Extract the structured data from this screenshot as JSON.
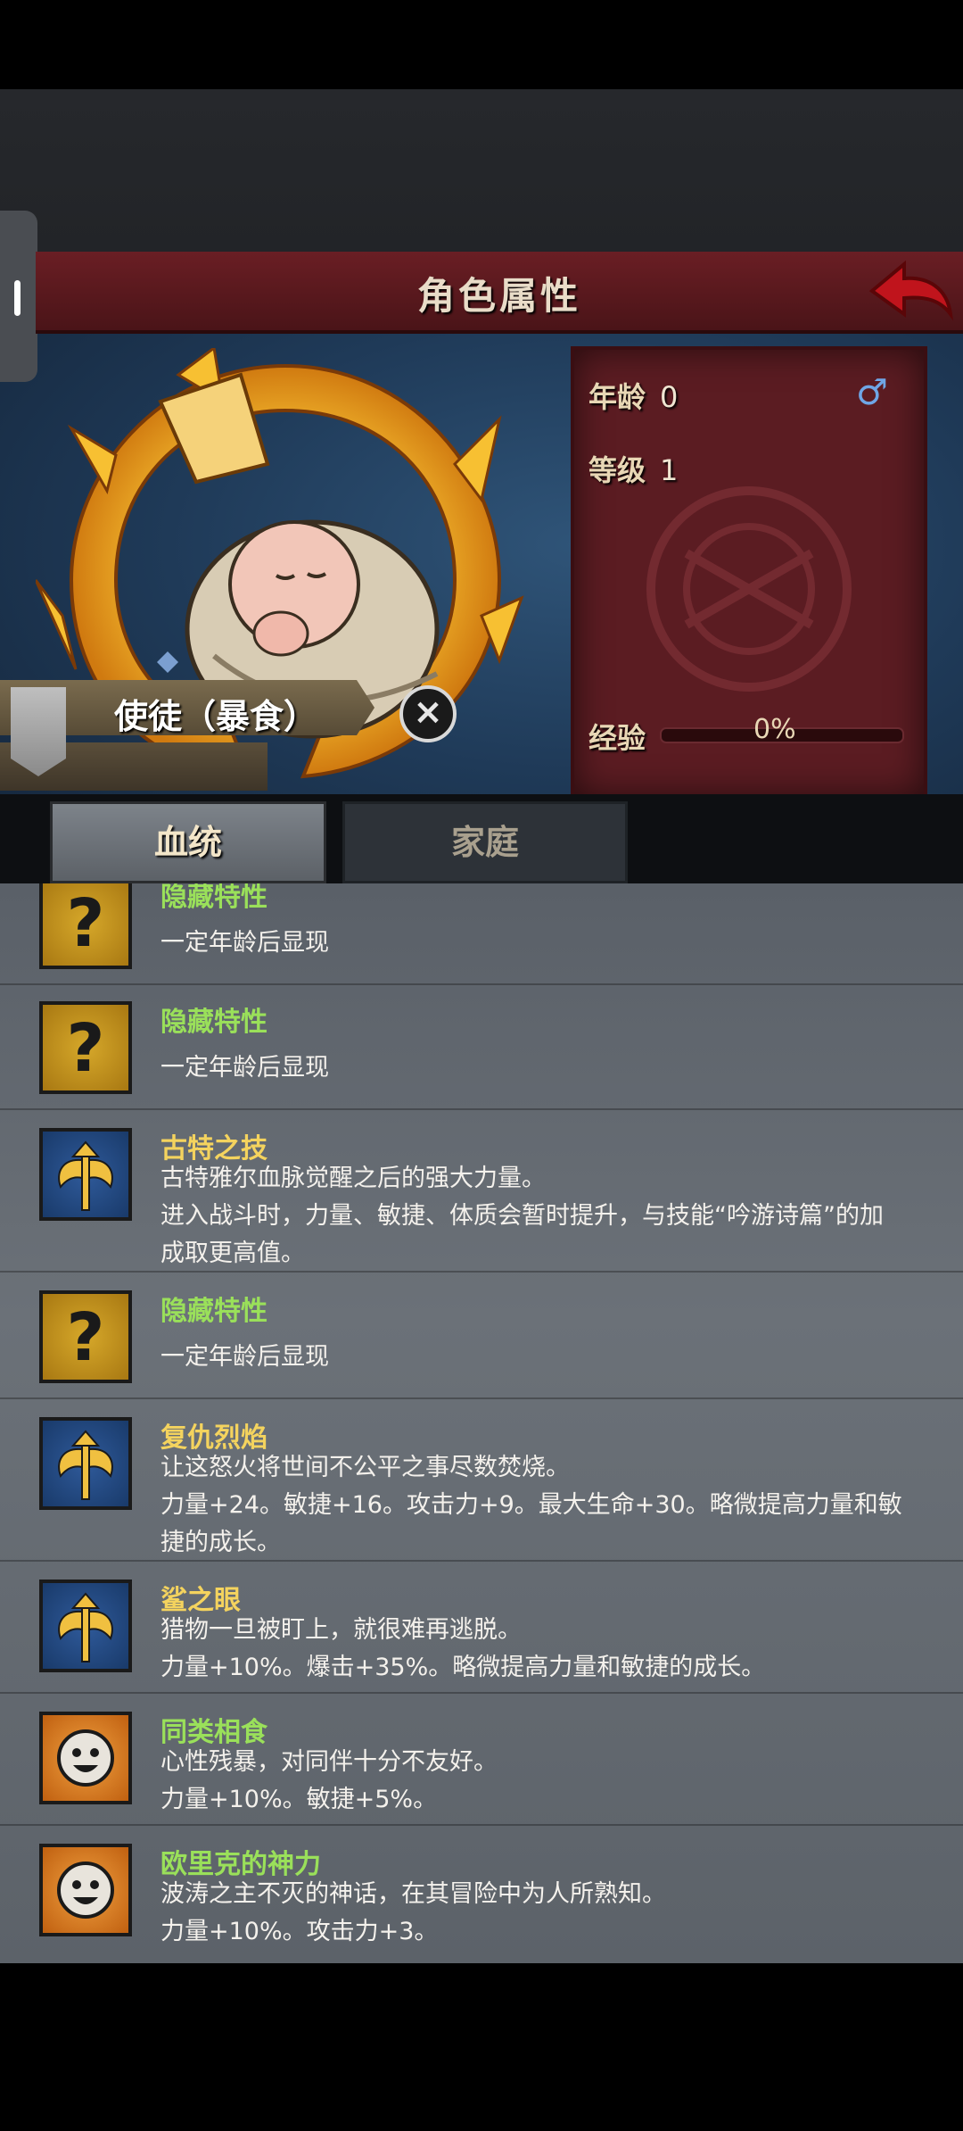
{
  "header": {
    "title": "角色属性"
  },
  "character": {
    "age_label": "年龄",
    "age_value": "0",
    "level_label": "等级",
    "level_value": "1",
    "exp_label": "经验",
    "exp_value": "0%",
    "exp_fraction": 0,
    "name": "使徒（暴食）",
    "gender_icon": "male-icon"
  },
  "tabs": [
    {
      "label": "血统"
    },
    {
      "label": "家庭"
    }
  ],
  "traits": [
    {
      "title": "隐藏特性",
      "desc": "一定年龄后显现",
      "icon": "question-icon",
      "title_color": "green"
    },
    {
      "title": "隐藏特性",
      "desc": "一定年龄后显现",
      "icon": "question-icon",
      "title_color": "green"
    },
    {
      "title": "古特之技",
      "desc": "古特雅尔血脉觉醒之后的强大力量。进入战斗时，力量、敏捷、体质会暂时提升，与技能“吟游诗篇”的加成取更高值。",
      "icon": "axe-icon",
      "title_color": "yellow"
    },
    {
      "title": "隐藏特性",
      "desc": "一定年龄后显现",
      "icon": "question-icon",
      "title_color": "green"
    },
    {
      "title": "复仇烈焰",
      "desc": "让这怒火将世间不公平之事尽数焚烧。力量+24。敏捷+16。攻击力+9。最大生命+30。略微提高力量和敏捷的成长。",
      "icon": "axe-icon",
      "title_color": "yellow"
    },
    {
      "title": "鲨之眼",
      "desc": "猎物一旦被盯上，就很难再逃脱。力量+10%。爆击+35%。略微提高力量和敏捷的成长。",
      "icon": "axe-icon",
      "title_color": "yellow"
    },
    {
      "title": "同类相食",
      "desc": "心性残暴，对同伴十分不友好。力量+10%。敏捷+5%。",
      "icon": "smile-icon",
      "title_color": "green"
    },
    {
      "title": "欧里克的神力",
      "desc": "波涛之主不灭的神话，在其冒险中为人所熟知。力量+10%。攻击力+3。",
      "icon": "smile-icon",
      "title_color": "green"
    }
  ],
  "trait_lines": [
    [
      "一定年龄后显现"
    ],
    [
      "一定年龄后显现"
    ],
    [
      "古特雅尔血脉觉醒之后的强大力量。",
      "进入战斗时，力量、敏捷、体质会暂时提升，与技能“吟游诗篇”的加",
      "成取更高值。"
    ],
    [
      "一定年龄后显现"
    ],
    [
      "让这怒火将世间不公平之事尽数焚烧。",
      "力量+24。敏捷+16。攻击力+9。最大生命+30。略微提高力量和敏",
      "捷的成长。"
    ],
    [
      "猎物一旦被盯上，就很难再逃脱。",
      "力量+10%。爆击+35%。略微提高力量和敏捷的成长。"
    ],
    [
      "心性残暴，对同伴十分不友好。",
      "力量+10%。敏捷+5%。"
    ],
    [
      "波涛之主不灭的神话，在其冒险中为人所熟知。",
      "力量+10%。攻击力+3。"
    ]
  ],
  "colors": {
    "green": "#9ae05a",
    "yellow": "#f4d35e",
    "banner": "#5b1c22"
  }
}
